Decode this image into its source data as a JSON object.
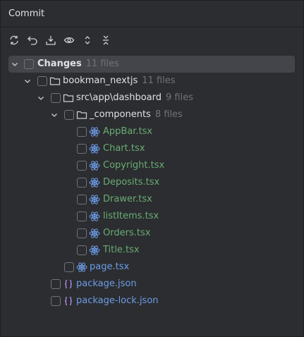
{
  "panel": {
    "title": "Commit"
  },
  "toolbar": {
    "buttons": [
      {
        "name": "refresh-button",
        "icon": "refresh-icon"
      },
      {
        "name": "rollback-button",
        "icon": "undo-icon"
      },
      {
        "name": "shelve-button",
        "icon": "download-icon"
      },
      {
        "name": "show-diff-button",
        "icon": "eye-icon"
      },
      {
        "name": "expand-all-button",
        "icon": "expand-icon"
      },
      {
        "name": "collapse-all-button",
        "icon": "collapse-icon"
      }
    ]
  },
  "colors": {
    "background": "#2b2d30",
    "selected_row": "#43454a",
    "added_file": "#6aab73",
    "modified_file": "#6e9ce8",
    "count": "#6f737a"
  },
  "tree": {
    "changes": {
      "label": "Changes",
      "count": "11 files"
    },
    "project": {
      "label": "bookman_nextjs",
      "count": "11 files"
    },
    "dashboard": {
      "label": "src\\app\\dashboard",
      "count": "9 files"
    },
    "components": {
      "label": "_components",
      "count": "8 files"
    },
    "component_files": [
      {
        "label": "AppBar.tsx"
      },
      {
        "label": "Chart.tsx"
      },
      {
        "label": "Copyright.tsx"
      },
      {
        "label": "Deposits.tsx"
      },
      {
        "label": "Drawer.tsx"
      },
      {
        "label": "listItems.tsx"
      },
      {
        "label": "Orders.tsx"
      },
      {
        "label": "Title.tsx"
      }
    ],
    "page_file": {
      "label": "page.tsx"
    },
    "package_json": {
      "label": "package.json"
    },
    "package_lock": {
      "label": "package-lock.json"
    }
  }
}
